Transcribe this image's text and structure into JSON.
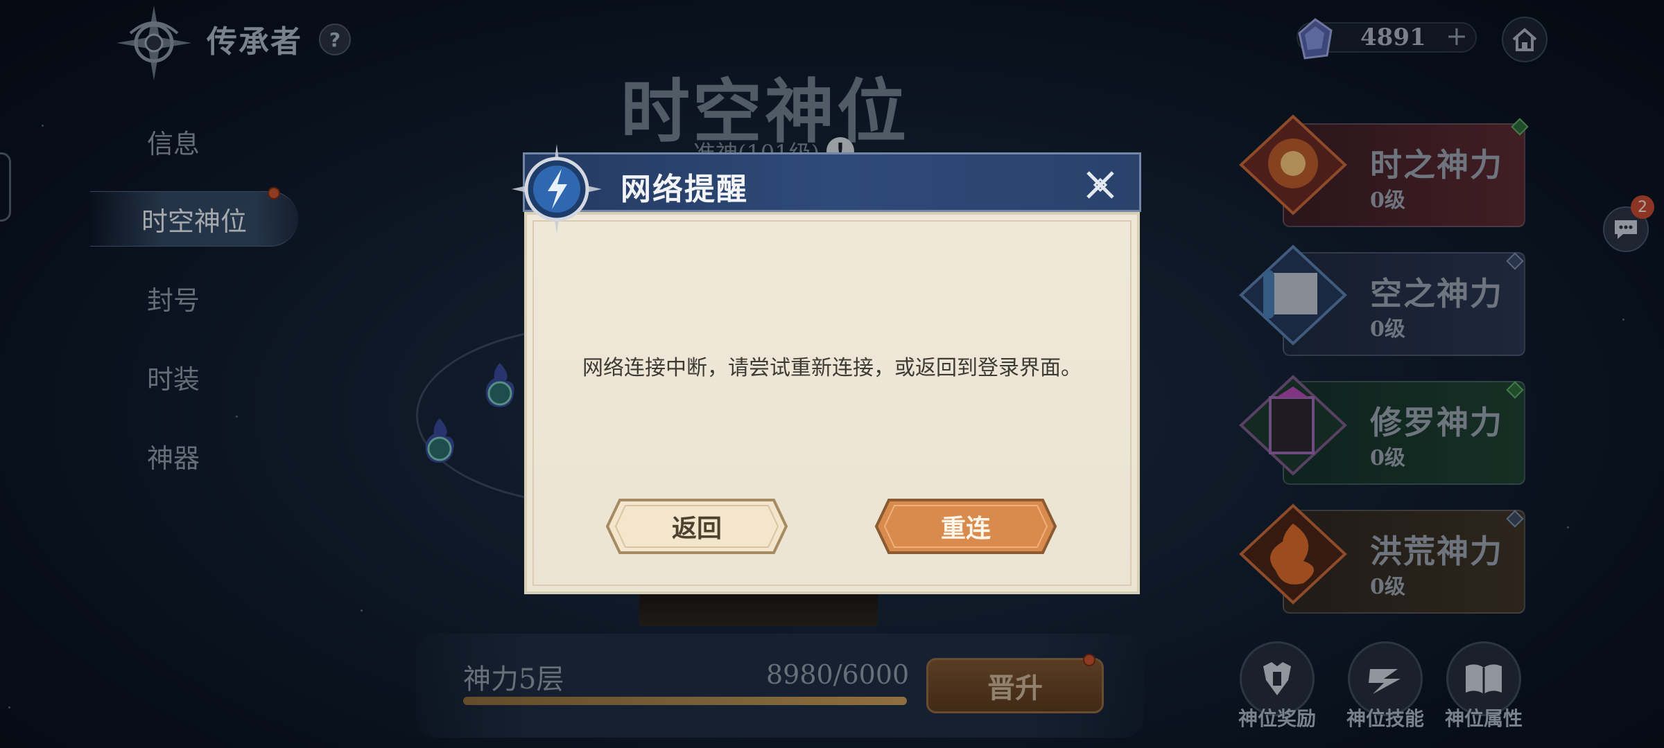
{
  "header": {
    "title": "传承者",
    "help_label": "?"
  },
  "nav": {
    "items": [
      {
        "label": "信息",
        "active": false
      },
      {
        "label": "时空神位",
        "active": true,
        "red_dot": true
      },
      {
        "label": "封号",
        "active": false
      },
      {
        "label": "时装",
        "active": false
      },
      {
        "label": "神器",
        "active": false
      }
    ]
  },
  "center": {
    "title": "时空神位",
    "subtitle": "准神(101级)",
    "subtitle_icon": "!"
  },
  "progress": {
    "label": "神力5层",
    "value_text": "8980/6000",
    "fill_fraction": 1.0,
    "promote_label": "晋升"
  },
  "currency": {
    "value": "4891",
    "plus": "+",
    "icon": "crystal-icon"
  },
  "powers": [
    {
      "name": "时之神力",
      "level": "0级",
      "color": "#5a2a32"
    },
    {
      "name": "空之神力",
      "level": "0级",
      "color": "#2a3652"
    },
    {
      "name": "修罗神力",
      "level": "0级",
      "color": "#1f4234"
    },
    {
      "name": "洪荒神力",
      "level": "0级",
      "color": "#3e3428"
    }
  ],
  "chat": {
    "badge": "2"
  },
  "bottom_actions": [
    {
      "label": "神位奖励",
      "icon": "armor-icon"
    },
    {
      "label": "神位技能",
      "icon": "skill-icon"
    },
    {
      "label": "神位属性",
      "icon": "book-icon"
    }
  ],
  "dialog": {
    "title": "网络提醒",
    "message": "网络连接中断，请尝试重新连接，或返回到登录界面。",
    "back_label": "返回",
    "reconnect_label": "重连",
    "accent": "#2e4a78",
    "primary_button_color": "#d98b4e"
  }
}
